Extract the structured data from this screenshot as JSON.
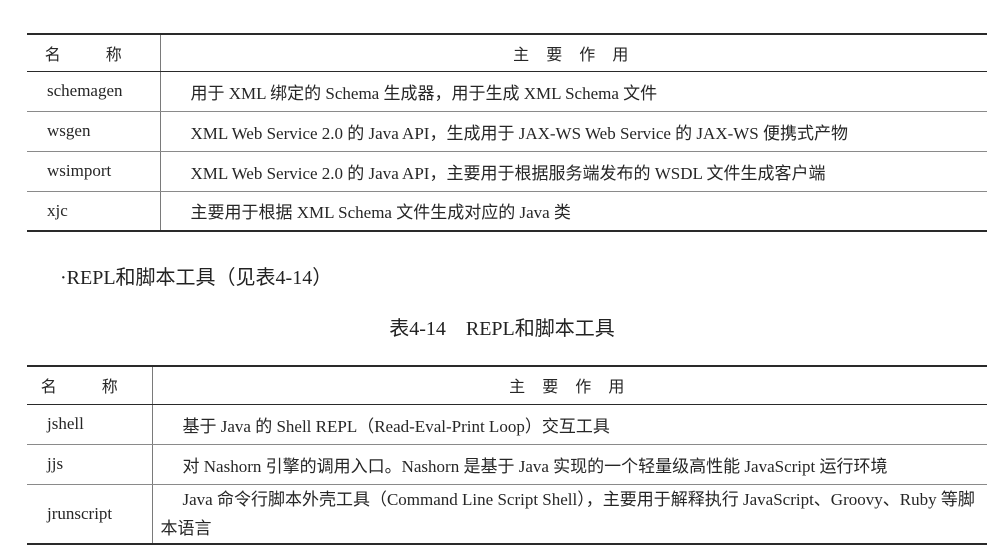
{
  "table1": {
    "header": {
      "name": "名 称",
      "role": "主 要 作 用"
    },
    "rows": [
      {
        "name": "schemagen",
        "desc": "用于 XML 绑定的 Schema 生成器，用于生成 XML Schema 文件"
      },
      {
        "name": "wsgen",
        "desc": "XML Web Service 2.0 的 Java API，生成用于 JAX-WS Web Service 的 JAX-WS 便携式产物"
      },
      {
        "name": "wsimport",
        "desc": "XML Web Service 2.0 的 Java API，主要用于根据服务端发布的 WSDL 文件生成客户端"
      },
      {
        "name": "xjc",
        "desc": "主要用于根据 XML Schema 文件生成对应的 Java 类"
      }
    ]
  },
  "bullet_text": "·REPL和脚本工具（见表4-14）",
  "caption": "表4-14　REPL和脚本工具",
  "table2": {
    "header": {
      "name": "名 称",
      "role": "主 要 作 用"
    },
    "rows": [
      {
        "name": "jshell",
        "desc": "基于 Java 的 Shell REPL（Read-Eval-Print Loop）交互工具"
      },
      {
        "name": "jjs",
        "desc": "对 Nashorn 引擎的调用入口。Nashorn 是基于 Java 实现的一个轻量级高性能 JavaScript 运行环境"
      },
      {
        "name": "jrunscript",
        "desc": "Java 命令行脚本外壳工具（Command Line Script Shell），主要用于解释执行 JavaScript、Groovy、Ruby 等脚本语言"
      }
    ]
  }
}
